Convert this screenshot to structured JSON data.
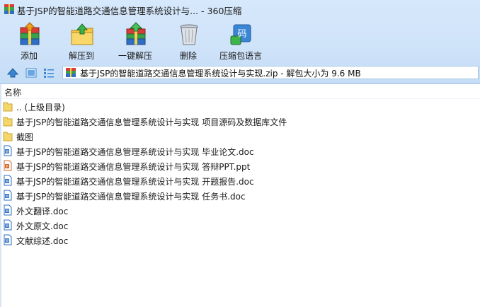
{
  "window": {
    "title": "基于JSP的智能道路交通信息管理系统设计与...  - 360压缩"
  },
  "toolbar": {
    "buttons": [
      {
        "label": "添加",
        "icon": "add-archive-icon"
      },
      {
        "label": "解压到",
        "icon": "extract-to-icon"
      },
      {
        "label": "一键解压",
        "icon": "one-click-extract-icon"
      },
      {
        "label": "删除",
        "icon": "delete-trash-icon"
      },
      {
        "label": "压缩包语言",
        "icon": "archive-language-icon"
      }
    ]
  },
  "pathbar": {
    "path": "基于JSP的智能道路交通信息管理系统设计与实现.zip - 解包大小为 9.6 MB"
  },
  "file_list": {
    "column_name": "名称",
    "items": [
      {
        "name": ".. (上级目录)",
        "type": "folder"
      },
      {
        "name": "基于JSP的智能道路交通信息管理系统设计与实现 项目源码及数据库文件",
        "type": "folder"
      },
      {
        "name": "截图",
        "type": "folder"
      },
      {
        "name": "基于JSP的智能道路交通信息管理系统设计与实现 毕业论文.doc",
        "type": "doc"
      },
      {
        "name": "基于JSP的智能道路交通信息管理系统设计与实现 答辩PPT.ppt",
        "type": "ppt"
      },
      {
        "name": "基于JSP的智能道路交通信息管理系统设计与实现 开题报告.doc",
        "type": "doc"
      },
      {
        "name": "基于JSP的智能道路交通信息管理系统设计与实现 任务书.doc",
        "type": "doc"
      },
      {
        "name": "外文翻译.doc",
        "type": "doc"
      },
      {
        "name": "外文原文.doc",
        "type": "doc"
      },
      {
        "name": "文献综述.doc",
        "type": "doc"
      }
    ]
  },
  "colors": {
    "toolbar_bg": "#cfe3f9",
    "folder": "#f5d66b",
    "doc_blue": "#2e6fc4",
    "ppt_orange": "#d5692a"
  }
}
